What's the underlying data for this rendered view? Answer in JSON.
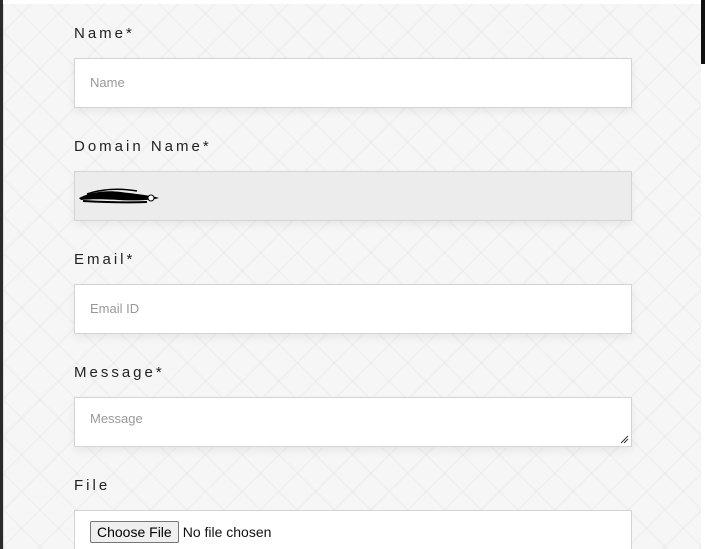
{
  "form": {
    "name": {
      "label": "Name*",
      "placeholder": "Name",
      "value": ""
    },
    "domain": {
      "label": "Domain Name*",
      "value": ""
    },
    "email": {
      "label": "Email*",
      "placeholder": "Email ID",
      "value": ""
    },
    "message": {
      "label": "Message*",
      "placeholder": "Message",
      "value": ""
    },
    "file": {
      "label": "File",
      "button_label": "Choose File",
      "status": "No file chosen"
    }
  }
}
